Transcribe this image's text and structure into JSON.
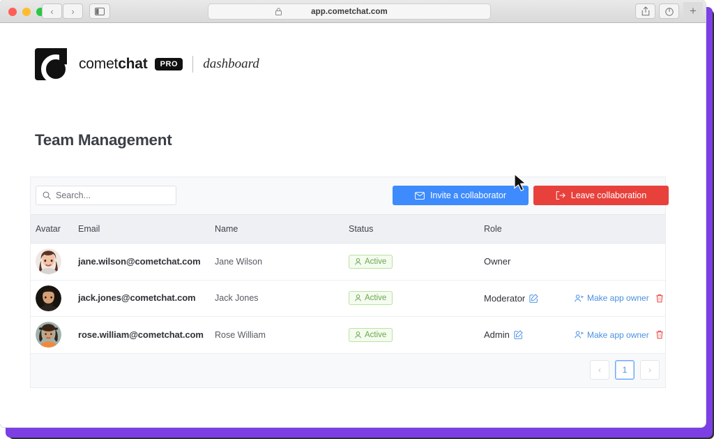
{
  "browser": {
    "url": "app.cometchat.com",
    "lock_icon": "lock-icon",
    "back_icon": "‹",
    "forward_icon": "›",
    "sidebar_icon": "sidebar-icon",
    "share_icon": "share-icon",
    "tabs_icon": "tabs-icon",
    "new_tab_label": "+"
  },
  "brand": {
    "logo_icon": "cometchat-logo-icon",
    "name_light": "comet",
    "name_bold": "chat",
    "pro_badge": "PRO",
    "dashboard_label": "dashboard"
  },
  "page": {
    "title": "Team Management"
  },
  "toolbar": {
    "search_placeholder": "Search...",
    "search_value": "",
    "search_icon": "search-icon",
    "invite_label": "Invite a collaborator",
    "invite_icon": "envelope-icon",
    "invite_color": "#3d8bfd",
    "leave_label": "Leave collaboration",
    "leave_icon": "logout-icon",
    "leave_color": "#e8413c"
  },
  "table": {
    "columns": [
      "Avatar",
      "Email",
      "Name",
      "Status",
      "Role"
    ],
    "rows": [
      {
        "avatar": "avatar-jane-wilson",
        "email": "jane.wilson@cometchat.com",
        "name": "Jane Wilson",
        "status": "Active",
        "status_icon": "user-icon",
        "role": "Owner",
        "has_role_edit": false,
        "actions": []
      },
      {
        "avatar": "avatar-jack-jones",
        "email": "jack.jones@cometchat.com",
        "name": "Jack Jones",
        "status": "Active",
        "status_icon": "user-icon",
        "role": "Moderator",
        "has_role_edit": true,
        "actions": [
          "Make app owner",
          "delete"
        ]
      },
      {
        "avatar": "avatar-rose-william",
        "email": "rose.william@cometchat.com",
        "name": "Rose William",
        "status": "Active",
        "status_icon": "user-icon",
        "role": "Admin",
        "has_role_edit": true,
        "actions": [
          "Make app owner",
          "delete"
        ]
      }
    ],
    "make_owner_label": "Make app owner",
    "make_owner_icon": "add-user-icon",
    "delete_icon": "trash-icon",
    "edit_icon": "edit-square-icon"
  },
  "pagination": {
    "prev_label": "‹",
    "current_page": "1",
    "next_label": "›"
  },
  "colors": {
    "accent_purple": "#7b3fe4",
    "link_blue": "#4a90e2",
    "status_green": "#6aa84f",
    "danger_red": "#e8413c"
  },
  "cursor": {
    "icon": "mouse-pointer-icon"
  }
}
